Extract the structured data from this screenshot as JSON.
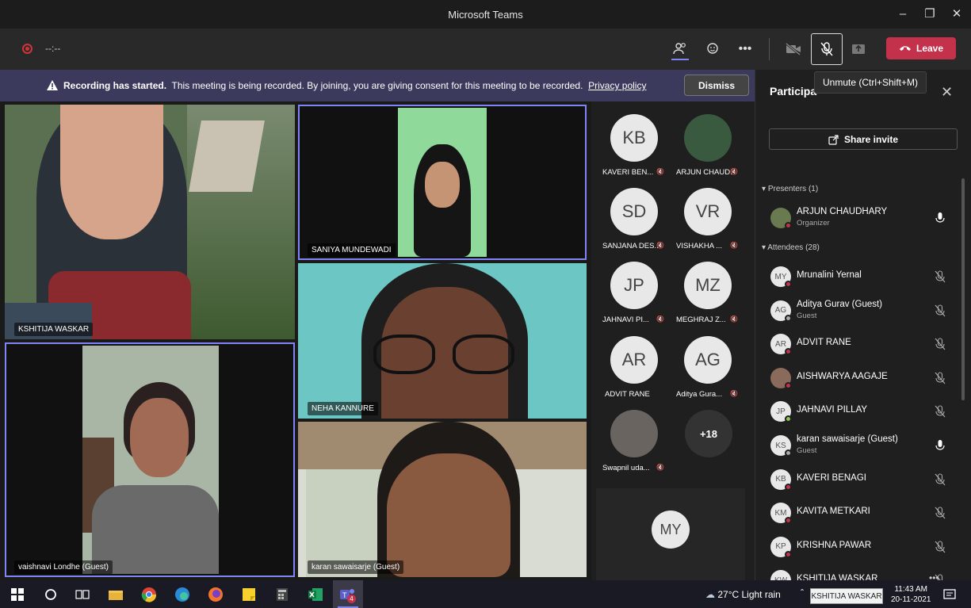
{
  "window": {
    "title": "Microsoft Teams"
  },
  "toolbar": {
    "timer": "--:--",
    "leave_label": "Leave"
  },
  "banner": {
    "bold_text": "Recording has started.",
    "text": "This meeting is being recorded. By joining, you are giving consent for this meeting to be recorded.",
    "link": "Privacy policy",
    "dismiss": "Dismiss"
  },
  "tiles": {
    "kshitija": "KSHITIJA WASKAR",
    "saniya": "SANIYA MUNDEWADI",
    "vaishnavi": "vaishnavi Londhe (Guest)",
    "neha": "NEHA KANNURE",
    "karan": "karan sawaisarje (Guest)"
  },
  "avatar_grid": [
    {
      "initials": "KB",
      "name": "KAVERI BEN..."
    },
    {
      "initials": "",
      "name": "ARJUN CHAUD..."
    },
    {
      "initials": "SD",
      "name": "SANJANA DES..."
    },
    {
      "initials": "VR",
      "name": "VISHAKHA ..."
    },
    {
      "initials": "JP",
      "name": "JAHNAVI PI..."
    },
    {
      "initials": "MZ",
      "name": "MEGHRAJ Z..."
    },
    {
      "initials": "AR",
      "name": "ADVIT RANE"
    },
    {
      "initials": "AG",
      "name": "Aditya Gura..."
    },
    {
      "initials": "",
      "name": "Swapnil uda..."
    }
  ],
  "overflow_count": "+18",
  "self_initials": "MY",
  "panel": {
    "title": "Participa",
    "tooltip": "Unmute (Ctrl+Shift+M)",
    "share_invite": "Share invite",
    "presenters_label": "Presenters (1)",
    "attendees_label": "Attendees (28)",
    "presenter": {
      "initials": "",
      "name": "ARJUN CHAUDHARY",
      "sub": "Organizer"
    },
    "attendees": [
      {
        "initials": "MY",
        "name": "Mrunalini Yernal",
        "sub": ""
      },
      {
        "initials": "AG",
        "name": "Aditya Gurav (Guest)",
        "sub": "Guest"
      },
      {
        "initials": "AR",
        "name": "ADVIT RANE",
        "sub": ""
      },
      {
        "initials": "",
        "name": "AISHWARYA AAGAJE",
        "sub": ""
      },
      {
        "initials": "JP",
        "name": "JAHNAVI PILLAY",
        "sub": ""
      },
      {
        "initials": "KS",
        "name": "karan sawaisarje (Guest)",
        "sub": "Guest"
      },
      {
        "initials": "KB",
        "name": "KAVERI BENAGI",
        "sub": ""
      },
      {
        "initials": "KM",
        "name": "KAVITA METKARI",
        "sub": ""
      },
      {
        "initials": "KP",
        "name": "KRISHNA PAWAR",
        "sub": ""
      },
      {
        "initials": "KW",
        "name": "KSHITIJA WASKAR",
        "sub": ""
      }
    ]
  },
  "taskbar": {
    "weather": "27°C  Light rain",
    "time": "11:43 AM",
    "date": "20-11-2021",
    "tooltip": "KSHITIJA WASKAR",
    "teams_badge": "4"
  },
  "colors": {
    "accent": "#7f85f5",
    "leave": "#c4314b",
    "banner": "#3b3a5c"
  }
}
